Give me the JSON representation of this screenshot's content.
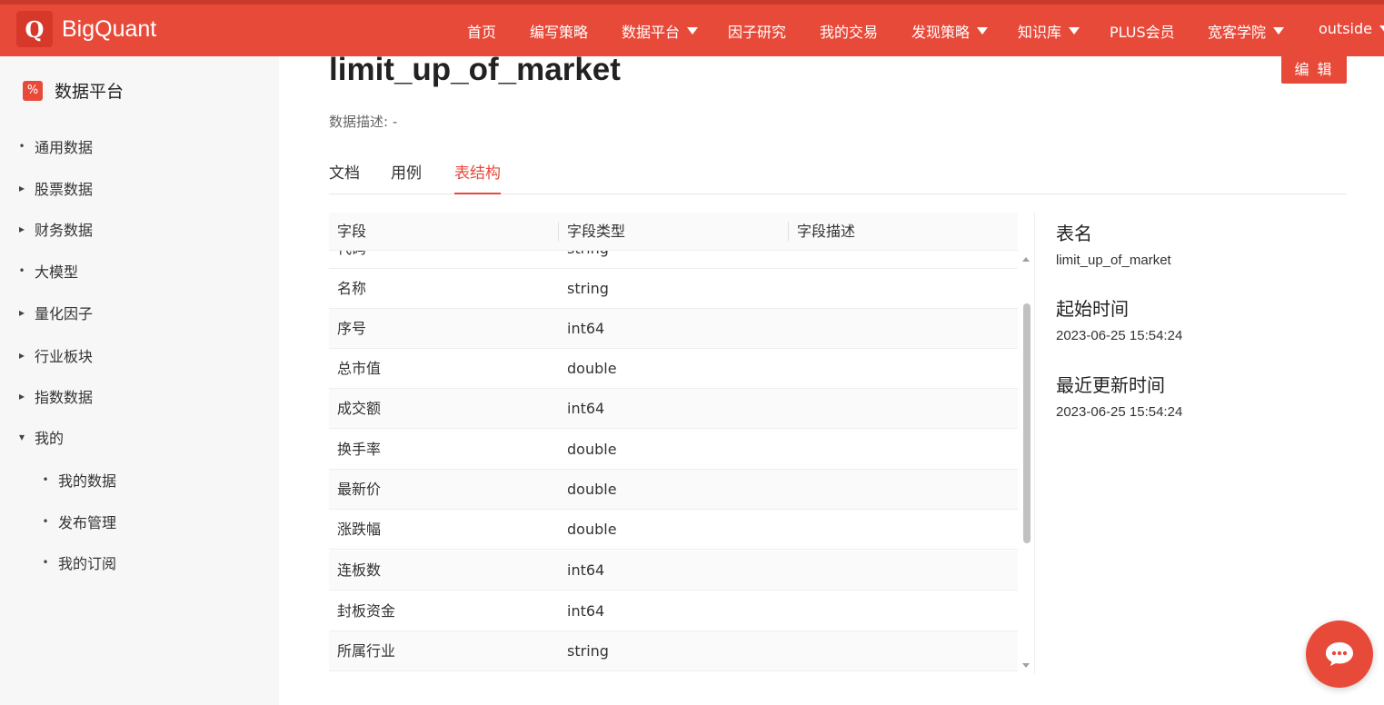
{
  "header": {
    "logo_letter": "Q",
    "brand": "BigQuant",
    "nav": [
      {
        "label": "首页",
        "dropdown": false
      },
      {
        "label": "编写策略",
        "dropdown": false
      },
      {
        "label": "数据平台",
        "dropdown": true
      },
      {
        "label": "因子研究",
        "dropdown": false
      },
      {
        "label": "我的交易",
        "dropdown": false
      },
      {
        "label": "发现策略",
        "dropdown": true
      },
      {
        "label": "知识库",
        "dropdown": true
      },
      {
        "label": "PLUS会员",
        "dropdown": false
      },
      {
        "label": "宽客学院",
        "dropdown": true
      },
      {
        "label": "outside",
        "dropdown": true
      }
    ]
  },
  "sidebar": {
    "title": "数据平台",
    "icon_glyph": "%",
    "items": [
      {
        "label": "通用数据",
        "marker": "•"
      },
      {
        "label": "股票数据",
        "marker": "▸"
      },
      {
        "label": "财务数据",
        "marker": "▸"
      },
      {
        "label": "大模型",
        "marker": "•"
      },
      {
        "label": "量化因子",
        "marker": "▸"
      },
      {
        "label": "行业板块",
        "marker": "▸"
      },
      {
        "label": "指数数据",
        "marker": "▸"
      },
      {
        "label": "我的",
        "marker": "▾"
      }
    ],
    "sub_items": [
      {
        "label": "我的数据",
        "marker": "•"
      },
      {
        "label": "发布管理",
        "marker": "•"
      },
      {
        "label": "我的订阅",
        "marker": "•"
      }
    ]
  },
  "main": {
    "title": "limit_up_of_market",
    "edit_label": "编 辑",
    "description": "数据描述: -",
    "tabs": [
      {
        "label": "文档",
        "active": false
      },
      {
        "label": "用例",
        "active": false
      },
      {
        "label": "表结构",
        "active": true
      }
    ],
    "table": {
      "columns": [
        "字段",
        "字段类型",
        "字段描述"
      ],
      "partial_row": {
        "field": "代码",
        "type": "string",
        "desc": ""
      },
      "rows": [
        {
          "field": "名称",
          "type": "string",
          "desc": ""
        },
        {
          "field": "序号",
          "type": "int64",
          "desc": ""
        },
        {
          "field": "总市值",
          "type": "double",
          "desc": ""
        },
        {
          "field": "成交额",
          "type": "int64",
          "desc": ""
        },
        {
          "field": "换手率",
          "type": "double",
          "desc": ""
        },
        {
          "field": "最新价",
          "type": "double",
          "desc": ""
        },
        {
          "field": "涨跌幅",
          "type": "double",
          "desc": ""
        },
        {
          "field": "连板数",
          "type": "int64",
          "desc": ""
        },
        {
          "field": "封板资金",
          "type": "int64",
          "desc": ""
        },
        {
          "field": "所属行业",
          "type": "string",
          "desc": ""
        }
      ]
    }
  },
  "info": {
    "table_name_label": "表名",
    "table_name": "limit_up_of_market",
    "start_label": "起始时间",
    "start_time": "2023-06-25 15:54:24",
    "update_label": "最近更新时间",
    "update_time": "2023-06-25 15:54:24"
  },
  "colors": {
    "brand": "#e84a3a",
    "sidebar_bg": "#f7f7f7"
  },
  "icons": {
    "chat": "chat-bubble-icon"
  }
}
